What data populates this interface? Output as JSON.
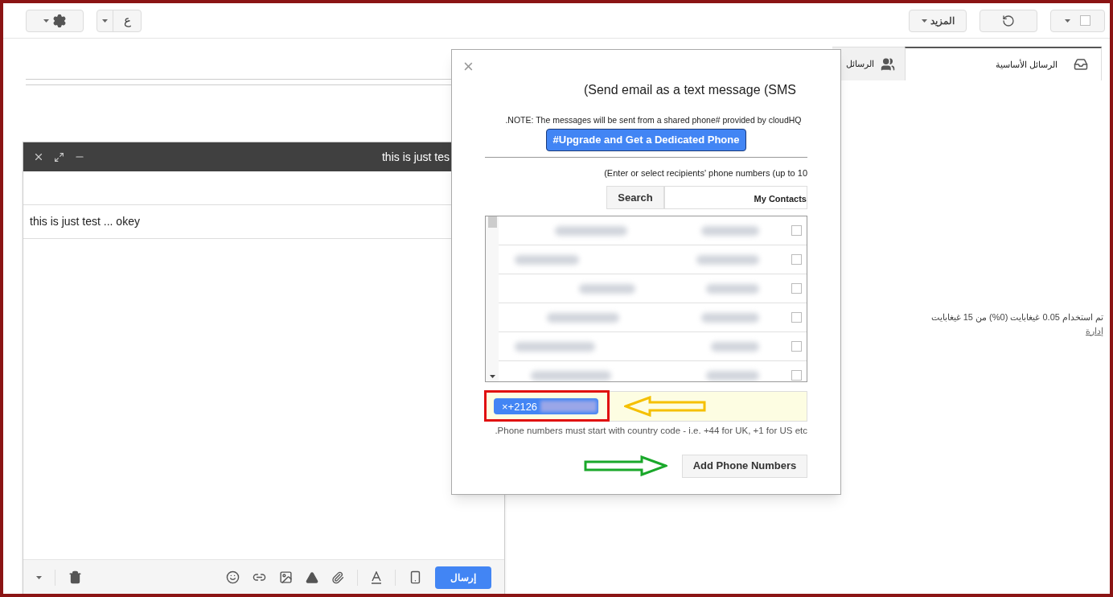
{
  "toolbar": {
    "input_tool_label": "ع",
    "more_label": "المزيد",
    "select_all_checked": false
  },
  "tabs": [
    {
      "label": "الرسائل الأساسية",
      "kind": "primary",
      "selected": true
    },
    {
      "label": "الرسائل",
      "kind": "social",
      "selected": false
    }
  ],
  "storage": {
    "usage": "تم استخدام 0.05 غيغابايت (0%) من 15 غيغابايت",
    "manage_link": "إدارة"
  },
  "compose": {
    "title": "this is just tes",
    "subject": "this is just test ... okey",
    "send_label": "إرسال"
  },
  "sms_dialog": {
    "close": "×",
    "title": "(Send email as a text message (SMS",
    "note": ".NOTE: The messages will be sent from a shared phone# provided by cloudHQ",
    "upgrade_label": "#Upgrade and Get a Dedicated Phone",
    "instructions": "(Enter or select recipients' phone numbers (up to 10",
    "search_label": "Search",
    "contacts_label": "My Contacts",
    "contacts": [
      {
        "checked": false
      },
      {
        "checked": false
      },
      {
        "checked": false
      },
      {
        "checked": false
      },
      {
        "checked": false
      },
      {
        "checked": false
      }
    ],
    "chips": [
      {
        "label": "×+2126"
      }
    ],
    "hint": ".Phone numbers must start with country code - i.e. +44 for UK, +1 for US etc",
    "add_label": "Add Phone Numbers"
  }
}
